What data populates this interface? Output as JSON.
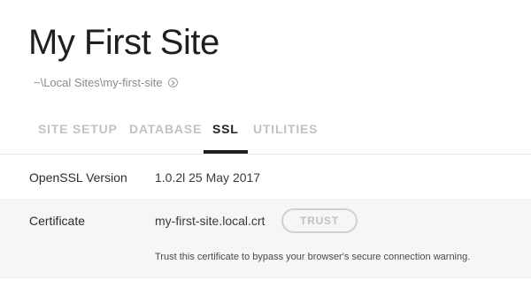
{
  "header": {
    "title": "My First Site",
    "path": "~\\Local Sites\\my-first-site",
    "path_icon": "circle-arrow-right-icon"
  },
  "tabs": [
    {
      "label": "SITE SETUP",
      "active": false
    },
    {
      "label": "DATABASE",
      "active": false
    },
    {
      "label": "SSL",
      "active": true
    },
    {
      "label": "UTILITIES",
      "active": false
    }
  ],
  "ssl": {
    "openssl_label": "OpenSSL Version",
    "openssl_value": "1.0.2l  25 May 2017",
    "certificate_label": "Certificate",
    "certificate_value": "my-first-site.local.crt",
    "trust_button": "TRUST",
    "trust_hint": "Trust this certificate to bypass your browser's secure connection warning."
  },
  "colors": {
    "active_tab": "#222222",
    "inactive_tab": "#c2c2c2",
    "row_alt_bg": "#f6f6f6"
  }
}
